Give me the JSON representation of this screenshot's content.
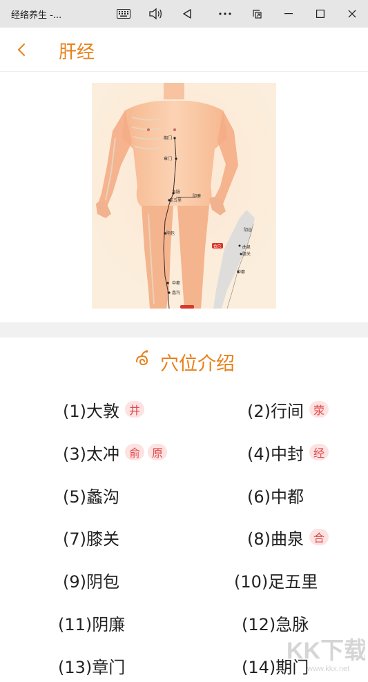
{
  "window": {
    "title": "经络养生 -..."
  },
  "header": {
    "title": "肝经"
  },
  "figure": {
    "points": [
      {
        "label": "期门"
      },
      {
        "label": "章门"
      },
      {
        "label": "急脉"
      },
      {
        "label": "足五里"
      },
      {
        "label": "阴廉"
      },
      {
        "label": "阴包"
      },
      {
        "label": "中都"
      },
      {
        "label": "蠡沟"
      },
      {
        "label": "曲泉"
      },
      {
        "label": "膝关"
      },
      {
        "label": "合穴"
      }
    ]
  },
  "section": {
    "title": "穴位介绍"
  },
  "acupoints": [
    {
      "name": "(1)大敦",
      "tags": [
        "井"
      ]
    },
    {
      "name": "(2)行间",
      "tags": [
        "荥"
      ]
    },
    {
      "name": "(3)太冲",
      "tags": [
        "俞",
        "原"
      ]
    },
    {
      "name": "(4)中封",
      "tags": [
        "经"
      ]
    },
    {
      "name": "(5)蠡沟",
      "tags": []
    },
    {
      "name": "(6)中都",
      "tags": []
    },
    {
      "name": "(7)膝关",
      "tags": []
    },
    {
      "name": "(8)曲泉",
      "tags": [
        "合"
      ]
    },
    {
      "name": "(9)阴包",
      "tags": []
    },
    {
      "name": "(10)足五里",
      "tags": []
    },
    {
      "name": "(11)阴廉",
      "tags": []
    },
    {
      "name": "(12)急脉",
      "tags": []
    },
    {
      "name": "(13)章门",
      "tags": []
    },
    {
      "name": "(14)期门",
      "tags": []
    }
  ],
  "watermark": {
    "text": "KK下载",
    "url": "www.kkx.net"
  },
  "colors": {
    "accent": "#e8801a",
    "tag_bg": "#fde2e2",
    "tag_text": "#e0494a"
  }
}
